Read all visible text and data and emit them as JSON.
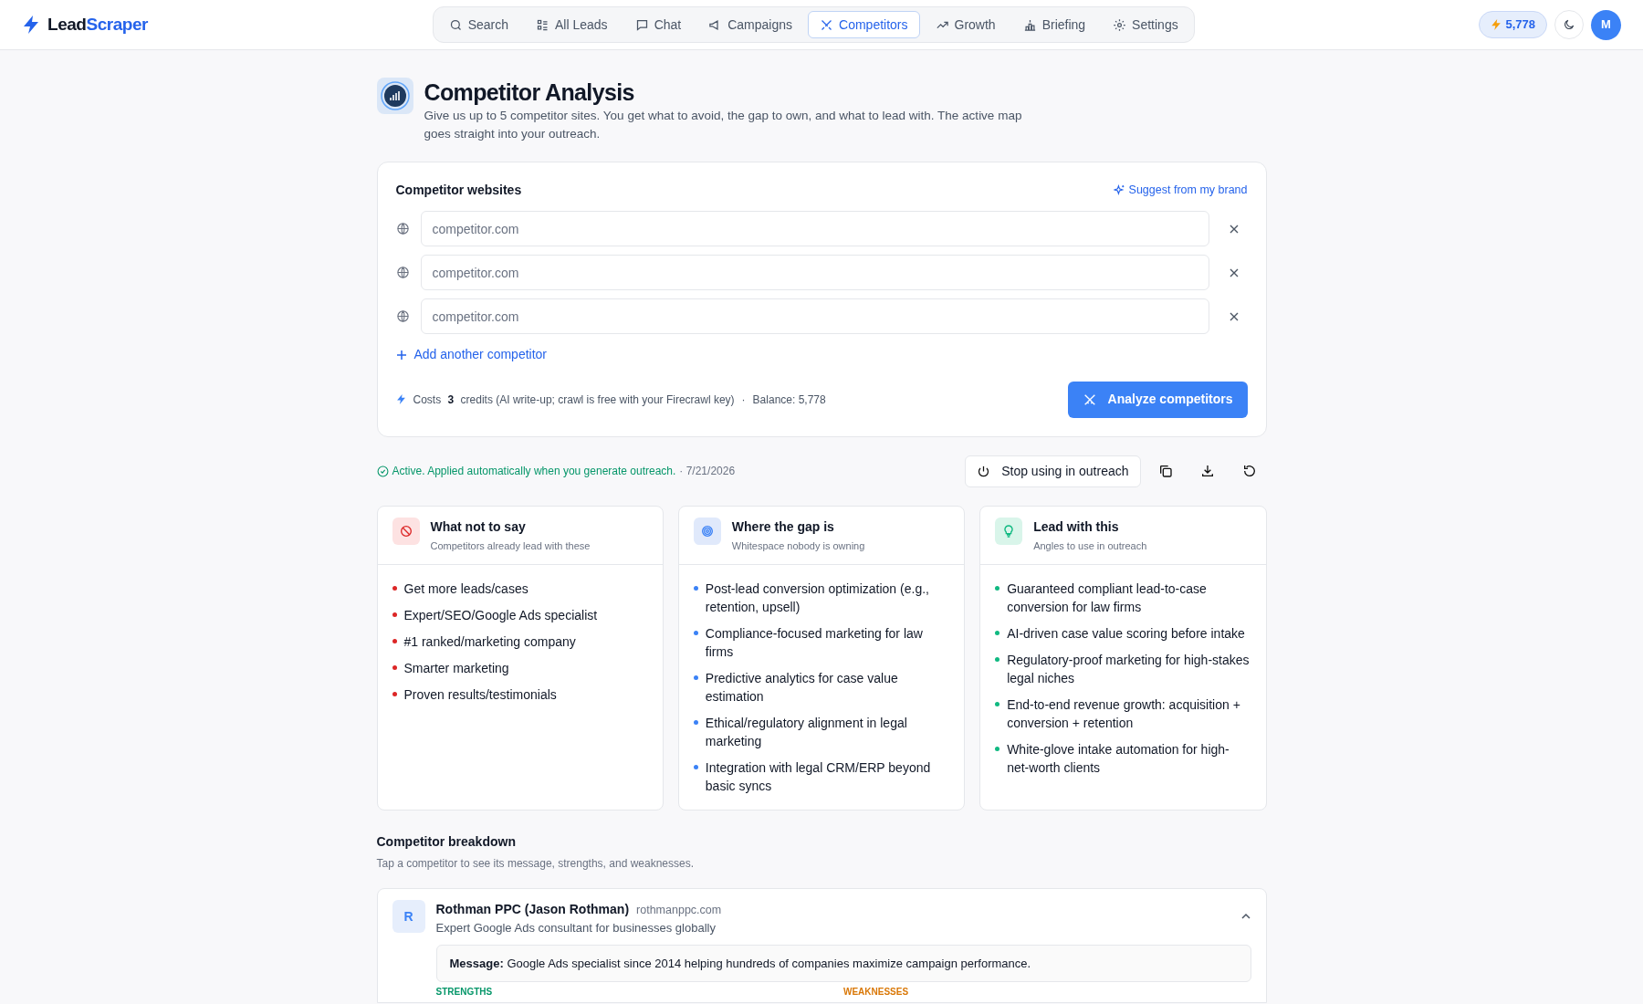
{
  "brand": {
    "first": "Lead",
    "second": "Scraper"
  },
  "nav": [
    {
      "label": "Search",
      "selected": false
    },
    {
      "label": "All Leads",
      "selected": false
    },
    {
      "label": "Chat",
      "selected": false
    },
    {
      "label": "Campaigns",
      "selected": false
    },
    {
      "label": "Competitors",
      "selected": true
    },
    {
      "label": "Growth",
      "selected": false
    },
    {
      "label": "Briefing",
      "selected": false
    },
    {
      "label": "Settings",
      "selected": false
    }
  ],
  "credits": "5,778",
  "avatar": "M",
  "page": {
    "title": "Competitor Analysis",
    "description": "Give us up to 5 competitor sites. You get what to avoid, the gap to own, and what to lead with. The active map goes straight into your outreach."
  },
  "websites": {
    "title": "Competitor websites",
    "suggest": "Suggest from my brand",
    "inputs": [
      {
        "placeholder": "competitor.com"
      },
      {
        "placeholder": "competitor.com"
      },
      {
        "placeholder": "competitor.com"
      }
    ],
    "add": "Add another competitor",
    "cost": {
      "prefix": "Costs",
      "amount": "3",
      "suffix": "credits (AI write-up; crawl is free with your Firecrawl key)",
      "separator": "·",
      "balance": "Balance: 5,778"
    },
    "button": "Analyze competitors"
  },
  "status": {
    "text": "Active. Applied automatically when you generate outreach.",
    "date": "· 7/21/2026",
    "stop": "Stop using in outreach"
  },
  "columns": [
    {
      "kind": "avoid",
      "title": "What not to say",
      "subtitle": "Competitors already lead with these",
      "color": "#dc2626",
      "items": [
        "Get more leads/cases",
        "Expert/SEO/Google Ads specialist",
        "#1 ranked/marketing company",
        "Smarter marketing",
        "Proven results/testimonials"
      ]
    },
    {
      "kind": "gap",
      "title": "Where the gap is",
      "subtitle": "Whitespace nobody is owning",
      "color": "#3b82f6",
      "items": [
        "Post-lead conversion optimization (e.g., retention, upsell)",
        "Compliance-focused marketing for law firms",
        "Predictive analytics for case value estimation",
        "Ethical/regulatory alignment in legal marketing",
        "Integration with legal CRM/ERP beyond basic syncs"
      ]
    },
    {
      "kind": "lead",
      "title": "Lead with this",
      "subtitle": "Angles to use in outreach",
      "color": "#10b981",
      "items": [
        "Guaranteed compliant lead-to-case conversion for law firms",
        "AI-driven case value scoring before intake",
        "Regulatory-proof marketing for high-stakes legal niches",
        "End-to-end revenue growth: acquisition + conversion + retention",
        "White-glove intake automation for high-net-worth clients"
      ]
    }
  ],
  "breakdown": {
    "title": "Competitor breakdown",
    "subtitle": "Tap a competitor to see its message, strengths, and weaknesses.",
    "competitors": [
      {
        "initial": "R",
        "name": "Rothman PPC (Jason Rothman)",
        "domain": "rothmanppc.com",
        "tagline": "Expert Google Ads consultant for businesses globally",
        "expanded": true,
        "message_label": "Message:",
        "message": "Google Ads specialist since 2014 helping hundreds of companies maximize campaign performance.",
        "strengths_label": "STRENGTHS",
        "weaknesses_label": "WEAKNESSES"
      }
    ]
  }
}
